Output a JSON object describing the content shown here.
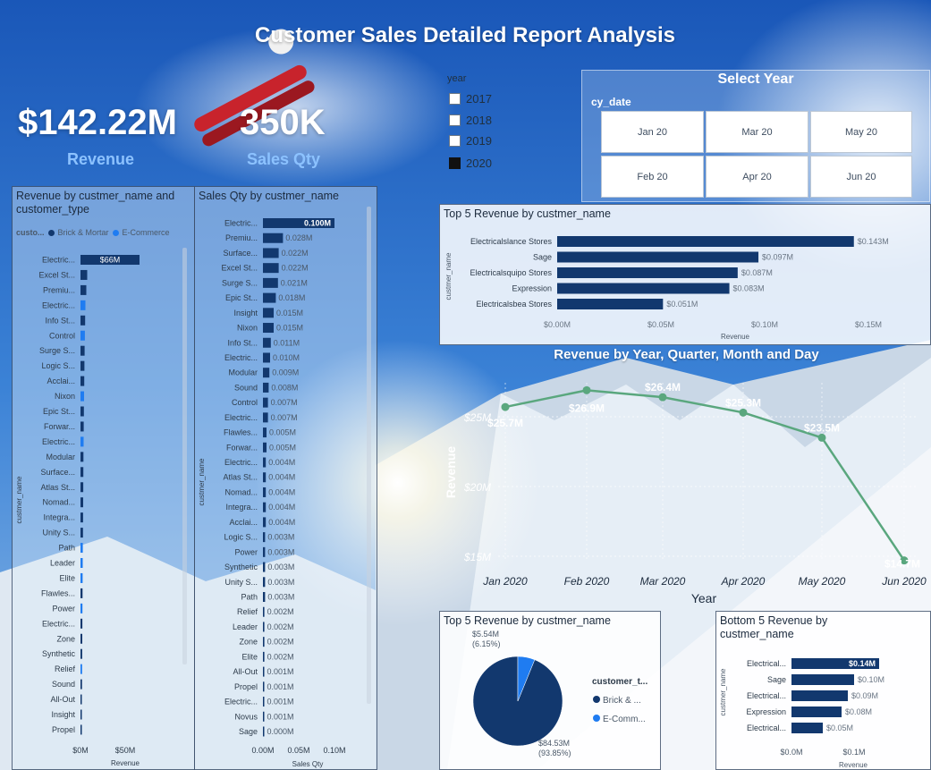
{
  "header": {
    "title": "Customer Sales Detailed Report Analysis"
  },
  "kpis": [
    {
      "value": "$142.22M",
      "label": "Revenue"
    },
    {
      "value": "350K",
      "label": "Sales Qty"
    }
  ],
  "year_slicer": {
    "title": "year",
    "options": [
      {
        "label": "2017",
        "checked": false
      },
      {
        "label": "2018",
        "checked": false
      },
      {
        "label": "2019",
        "checked": false
      },
      {
        "label": "2020",
        "checked": true
      }
    ]
  },
  "select_year": {
    "title": "Select Year",
    "field": "cy_date",
    "tiles": [
      "Jan 20",
      "Mar 20",
      "May 20",
      "Feb 20",
      "Apr 20",
      "Jun 20"
    ]
  },
  "legend_customer_type": {
    "title": "custo...",
    "items": [
      "Brick & Mortar",
      "E-Commerce"
    ],
    "colors": [
      "#12386e",
      "#1f7cf1"
    ]
  },
  "chart_data": [
    {
      "id": "revenue_by_customer",
      "type": "bar",
      "orientation": "horizontal",
      "title": "Revenue by custmer_name and customer_type",
      "xlabel": "Revenue",
      "ylabel": "custmer_name",
      "x_ticks": [
        "$0M",
        "$50M"
      ],
      "xlim": [
        0,
        90
      ],
      "data_label": "$66M",
      "categories": [
        "Electric...",
        "Excel St...",
        "Premiu...",
        "Electric...",
        "Info St...",
        "Control",
        "Surge S...",
        "Logic S...",
        "Acclai...",
        "Nixon",
        "Epic St...",
        "Forwar...",
        "Electric...",
        "Modular",
        "Surface...",
        "Atlas St...",
        "Nomad...",
        "Integra...",
        "Unity S...",
        "Path",
        "Leader",
        "Elite",
        "Flawles...",
        "Power",
        "Electric...",
        "Zone",
        "Synthetic",
        "Relief",
        "Sound",
        "All-Out",
        "Insight",
        "Propel"
      ],
      "values": [
        66,
        7.5,
        6.5,
        5.5,
        5.2,
        4.9,
        4.6,
        4.4,
        4.2,
        4.0,
        3.8,
        3.6,
        3.5,
        3.3,
        3.2,
        3.1,
        3.0,
        2.9,
        2.8,
        2.6,
        2.5,
        2.4,
        2.3,
        2.2,
        2.1,
        2.0,
        1.9,
        1.8,
        1.7,
        1.5,
        1.4,
        1.3
      ],
      "types": [
        "Brick & Mortar",
        "Brick & Mortar",
        "Brick & Mortar",
        "E-Commerce",
        "Brick & Mortar",
        "E-Commerce",
        "Brick & Mortar",
        "Brick & Mortar",
        "Brick & Mortar",
        "E-Commerce",
        "Brick & Mortar",
        "Brick & Mortar",
        "E-Commerce",
        "Brick & Mortar",
        "Brick & Mortar",
        "Brick & Mortar",
        "Brick & Mortar",
        "Brick & Mortar",
        "Brick & Mortar",
        "E-Commerce",
        "E-Commerce",
        "E-Commerce",
        "Brick & Mortar",
        "E-Commerce",
        "Brick & Mortar",
        "Brick & Mortar",
        "Brick & Mortar",
        "E-Commerce",
        "Brick & Mortar",
        "Brick & Mortar",
        "Brick & Mortar",
        "Brick & Mortar"
      ]
    },
    {
      "id": "salesqty_by_customer",
      "type": "bar",
      "orientation": "horizontal",
      "title": "Sales Qty by custmer_name",
      "xlabel": "Sales Qty",
      "ylabel": "custmer_name",
      "x_ticks": [
        "0.00M",
        "0.05M",
        "0.10M"
      ],
      "xlim": [
        0,
        0.1
      ],
      "categories": [
        "Electric...",
        "Premiu...",
        "Surface...",
        "Excel St...",
        "Surge S...",
        "Epic St...",
        "Insight",
        "Nixon",
        "Info St...",
        "Electric...",
        "Modular",
        "Sound",
        "Control",
        "Electric...",
        "Flawles...",
        "Forwar...",
        "Electric...",
        "Atlas St...",
        "Nomad...",
        "Integra...",
        "Acclai...",
        "Logic S...",
        "Power",
        "Synthetic",
        "Unity S...",
        "Path",
        "Relief",
        "Leader",
        "Zone",
        "Elite",
        "All-Out",
        "Propel",
        "Electric...",
        "Novus",
        "Sage"
      ],
      "values": [
        0.1,
        0.028,
        0.022,
        0.022,
        0.021,
        0.018,
        0.015,
        0.015,
        0.011,
        0.01,
        0.009,
        0.008,
        0.007,
        0.007,
        0.005,
        0.005,
        0.004,
        0.004,
        0.004,
        0.004,
        0.004,
        0.003,
        0.003,
        0.003,
        0.003,
        0.003,
        0.002,
        0.002,
        0.002,
        0.002,
        0.001,
        0.001,
        0.001,
        0.001,
        0.0
      ],
      "labels": [
        "0.100M",
        "0.028M",
        "0.022M",
        "0.022M",
        "0.021M",
        "0.018M",
        "0.015M",
        "0.015M",
        "0.011M",
        "0.010M",
        "0.009M",
        "0.008M",
        "0.007M",
        "0.007M",
        "0.005M",
        "0.005M",
        "0.004M",
        "0.004M",
        "0.004M",
        "0.004M",
        "0.004M",
        "0.003M",
        "0.003M",
        "0.003M",
        "0.003M",
        "0.003M",
        "0.002M",
        "0.002M",
        "0.002M",
        "0.002M",
        "0.001M",
        "0.001M",
        "0.001M",
        "0.001M",
        "0.000M"
      ]
    },
    {
      "id": "top5_revenue_bar",
      "type": "bar",
      "orientation": "horizontal",
      "title": "Top 5 Revenue by custmer_name",
      "xlabel": "Revenue",
      "ylabel": "custmer_name",
      "x_ticks": [
        "$0.00M",
        "$0.05M",
        "$0.10M",
        "$0.15M"
      ],
      "xlim": [
        0,
        0.15
      ],
      "categories": [
        "Electricalslance Stores",
        "Sage",
        "Electricalsquipo Stores",
        "Expression",
        "Electricalsbea Stores"
      ],
      "values": [
        0.143,
        0.097,
        0.087,
        0.083,
        0.051
      ],
      "labels": [
        "$0.143M",
        "$0.097M",
        "$0.087M",
        "$0.083M",
        "$0.051M"
      ]
    },
    {
      "id": "revenue_trend",
      "type": "line",
      "title": "Revenue by Year, Quarter, Month and Day",
      "xlabel": "Year",
      "ylabel": "Revenue",
      "y_ticks": [
        "$15M",
        "$20M",
        "$25M"
      ],
      "ylim": [
        15,
        27
      ],
      "x": [
        "Jan 2020",
        "Feb 2020",
        "Mar 2020",
        "Apr 2020",
        "May 2020",
        "Jun 2020"
      ],
      "values": [
        25.7,
        26.9,
        26.4,
        25.3,
        23.5,
        14.7
      ],
      "labels": [
        "$25.7M",
        "$26.9M",
        "$26.4M",
        "$25.3M",
        "$23.5M",
        "$14.7M"
      ],
      "color": "#5aa77e"
    },
    {
      "id": "top5_revenue_pie",
      "type": "pie",
      "title": "Top 5 Revenue by custmer_name",
      "legend_title": "customer_t...",
      "categories": [
        "Brick & ...",
        "E-Comm..."
      ],
      "values": [
        84.53,
        5.54
      ],
      "labels": [
        "$84.53M",
        "$5.54M"
      ],
      "percents": [
        "(93.85%)",
        "(6.15%)"
      ],
      "colors": [
        "#12386e",
        "#1f7cf1"
      ]
    },
    {
      "id": "bottom5_revenue_bar",
      "type": "bar",
      "orientation": "horizontal",
      "title": "Bottom 5 Revenue by custmer_name",
      "xlabel": "Revenue",
      "ylabel": "custmer_name",
      "x_ticks": [
        "$0.0M",
        "$0.1M"
      ],
      "xlim": [
        0,
        0.16
      ],
      "categories": [
        "Electrical...",
        "Sage",
        "Electrical...",
        "Expression",
        "Electrical..."
      ],
      "values": [
        0.14,
        0.1,
        0.09,
        0.08,
        0.05
      ],
      "labels": [
        "$0.14M",
        "$0.10M",
        "$0.09M",
        "$0.08M",
        "$0.05M"
      ]
    }
  ]
}
